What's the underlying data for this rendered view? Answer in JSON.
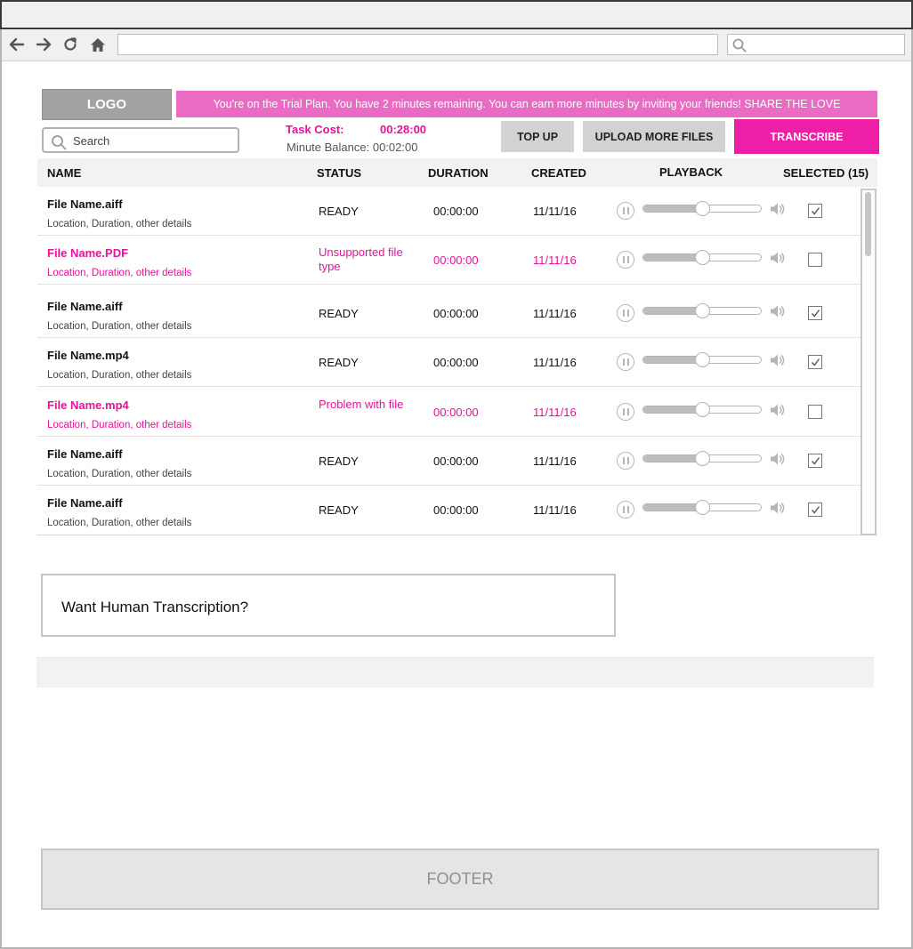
{
  "header": {
    "logo": "LOGO",
    "banner": "You're on the Trial Plan. You have 2 minutes remaining. You can earn more minutes by inviting your friends! SHARE THE LOVE"
  },
  "search": {
    "placeholder": "Search"
  },
  "task": {
    "cost_label": "Task Cost:",
    "cost_value": "00:28:00",
    "balance": "Minute Balance: 00:02:00"
  },
  "buttons": {
    "top_up": "TOP UP",
    "upload": "UPLOAD MORE FILES",
    "transcribe": "TRANSCRIBE"
  },
  "table": {
    "headers": {
      "name": "NAME",
      "status": "STATUS",
      "duration": "DURATION",
      "created": "CREATED",
      "playback": "PLAYBACK",
      "selected": "SELECTED (15)"
    },
    "rows": [
      {
        "name": "File Name.aiff",
        "details": "Location, Duration, other details",
        "status": "READY",
        "duration": "00:00:00",
        "created": "11/11/16",
        "playback_progress": 0.5,
        "selected": true,
        "error": false
      },
      {
        "name": "File Name.PDF",
        "details": "Location, Duration, other details",
        "status": "Unsupported file type",
        "duration": "00:00:00",
        "created": "11/11/16",
        "playback_progress": 0.5,
        "selected": false,
        "error": true
      },
      {
        "name": "File Name.aiff",
        "details": "Location, Duration, other details",
        "status": "READY",
        "duration": "00:00:00",
        "created": "11/11/16",
        "playback_progress": 0.5,
        "selected": true,
        "error": false
      },
      {
        "name": "File Name.mp4",
        "details": "Location, Duration, other details",
        "status": "READY",
        "duration": "00:00:00",
        "created": "11/11/16",
        "playback_progress": 0.5,
        "selected": true,
        "error": false
      },
      {
        "name": "File Name.mp4",
        "details": "Location, Duration, other details",
        "status": "Problem with file",
        "duration": "00:00:00",
        "created": "11/11/16",
        "playback_progress": 0.5,
        "selected": false,
        "error": true
      },
      {
        "name": "File Name.aiff",
        "details": "Location, Duration, other details",
        "status": "READY",
        "duration": "00:00:00",
        "created": "11/11/16",
        "playback_progress": 0.5,
        "selected": true,
        "error": false
      },
      {
        "name": "File Name.aiff",
        "details": "Location, Duration, other details",
        "status": "READY",
        "duration": "00:00:00",
        "created": "11/11/16",
        "playback_progress": 0.5,
        "selected": true,
        "error": false
      }
    ]
  },
  "human": {
    "title": "Want Human Transcription?"
  },
  "footer": {
    "label": "FOOTER"
  },
  "colors": {
    "accent": "#ee1fa6",
    "banner": "#ea6bc4",
    "logo": "#a2a2a2"
  }
}
